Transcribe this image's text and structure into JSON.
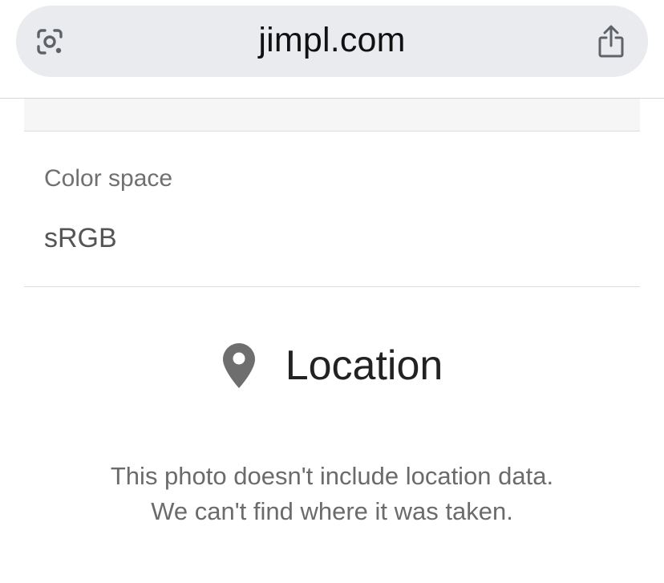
{
  "browser": {
    "url": "jimpl.com",
    "icons": {
      "lens": "camera-lens-icon",
      "share": "share-icon"
    }
  },
  "metadata": {
    "row": {
      "label": "Color space",
      "value": "sRGB"
    }
  },
  "location": {
    "icon": "map-pin-icon",
    "title": "Location",
    "message_line1": "This photo doesn't include location data.",
    "message_line2": "We can't find where it was taken."
  },
  "colors": {
    "url_pill": "#e9ebee",
    "label": "#707070",
    "value": "#555555",
    "pin": "#6e6e6e",
    "message": "#6b6b6b"
  }
}
